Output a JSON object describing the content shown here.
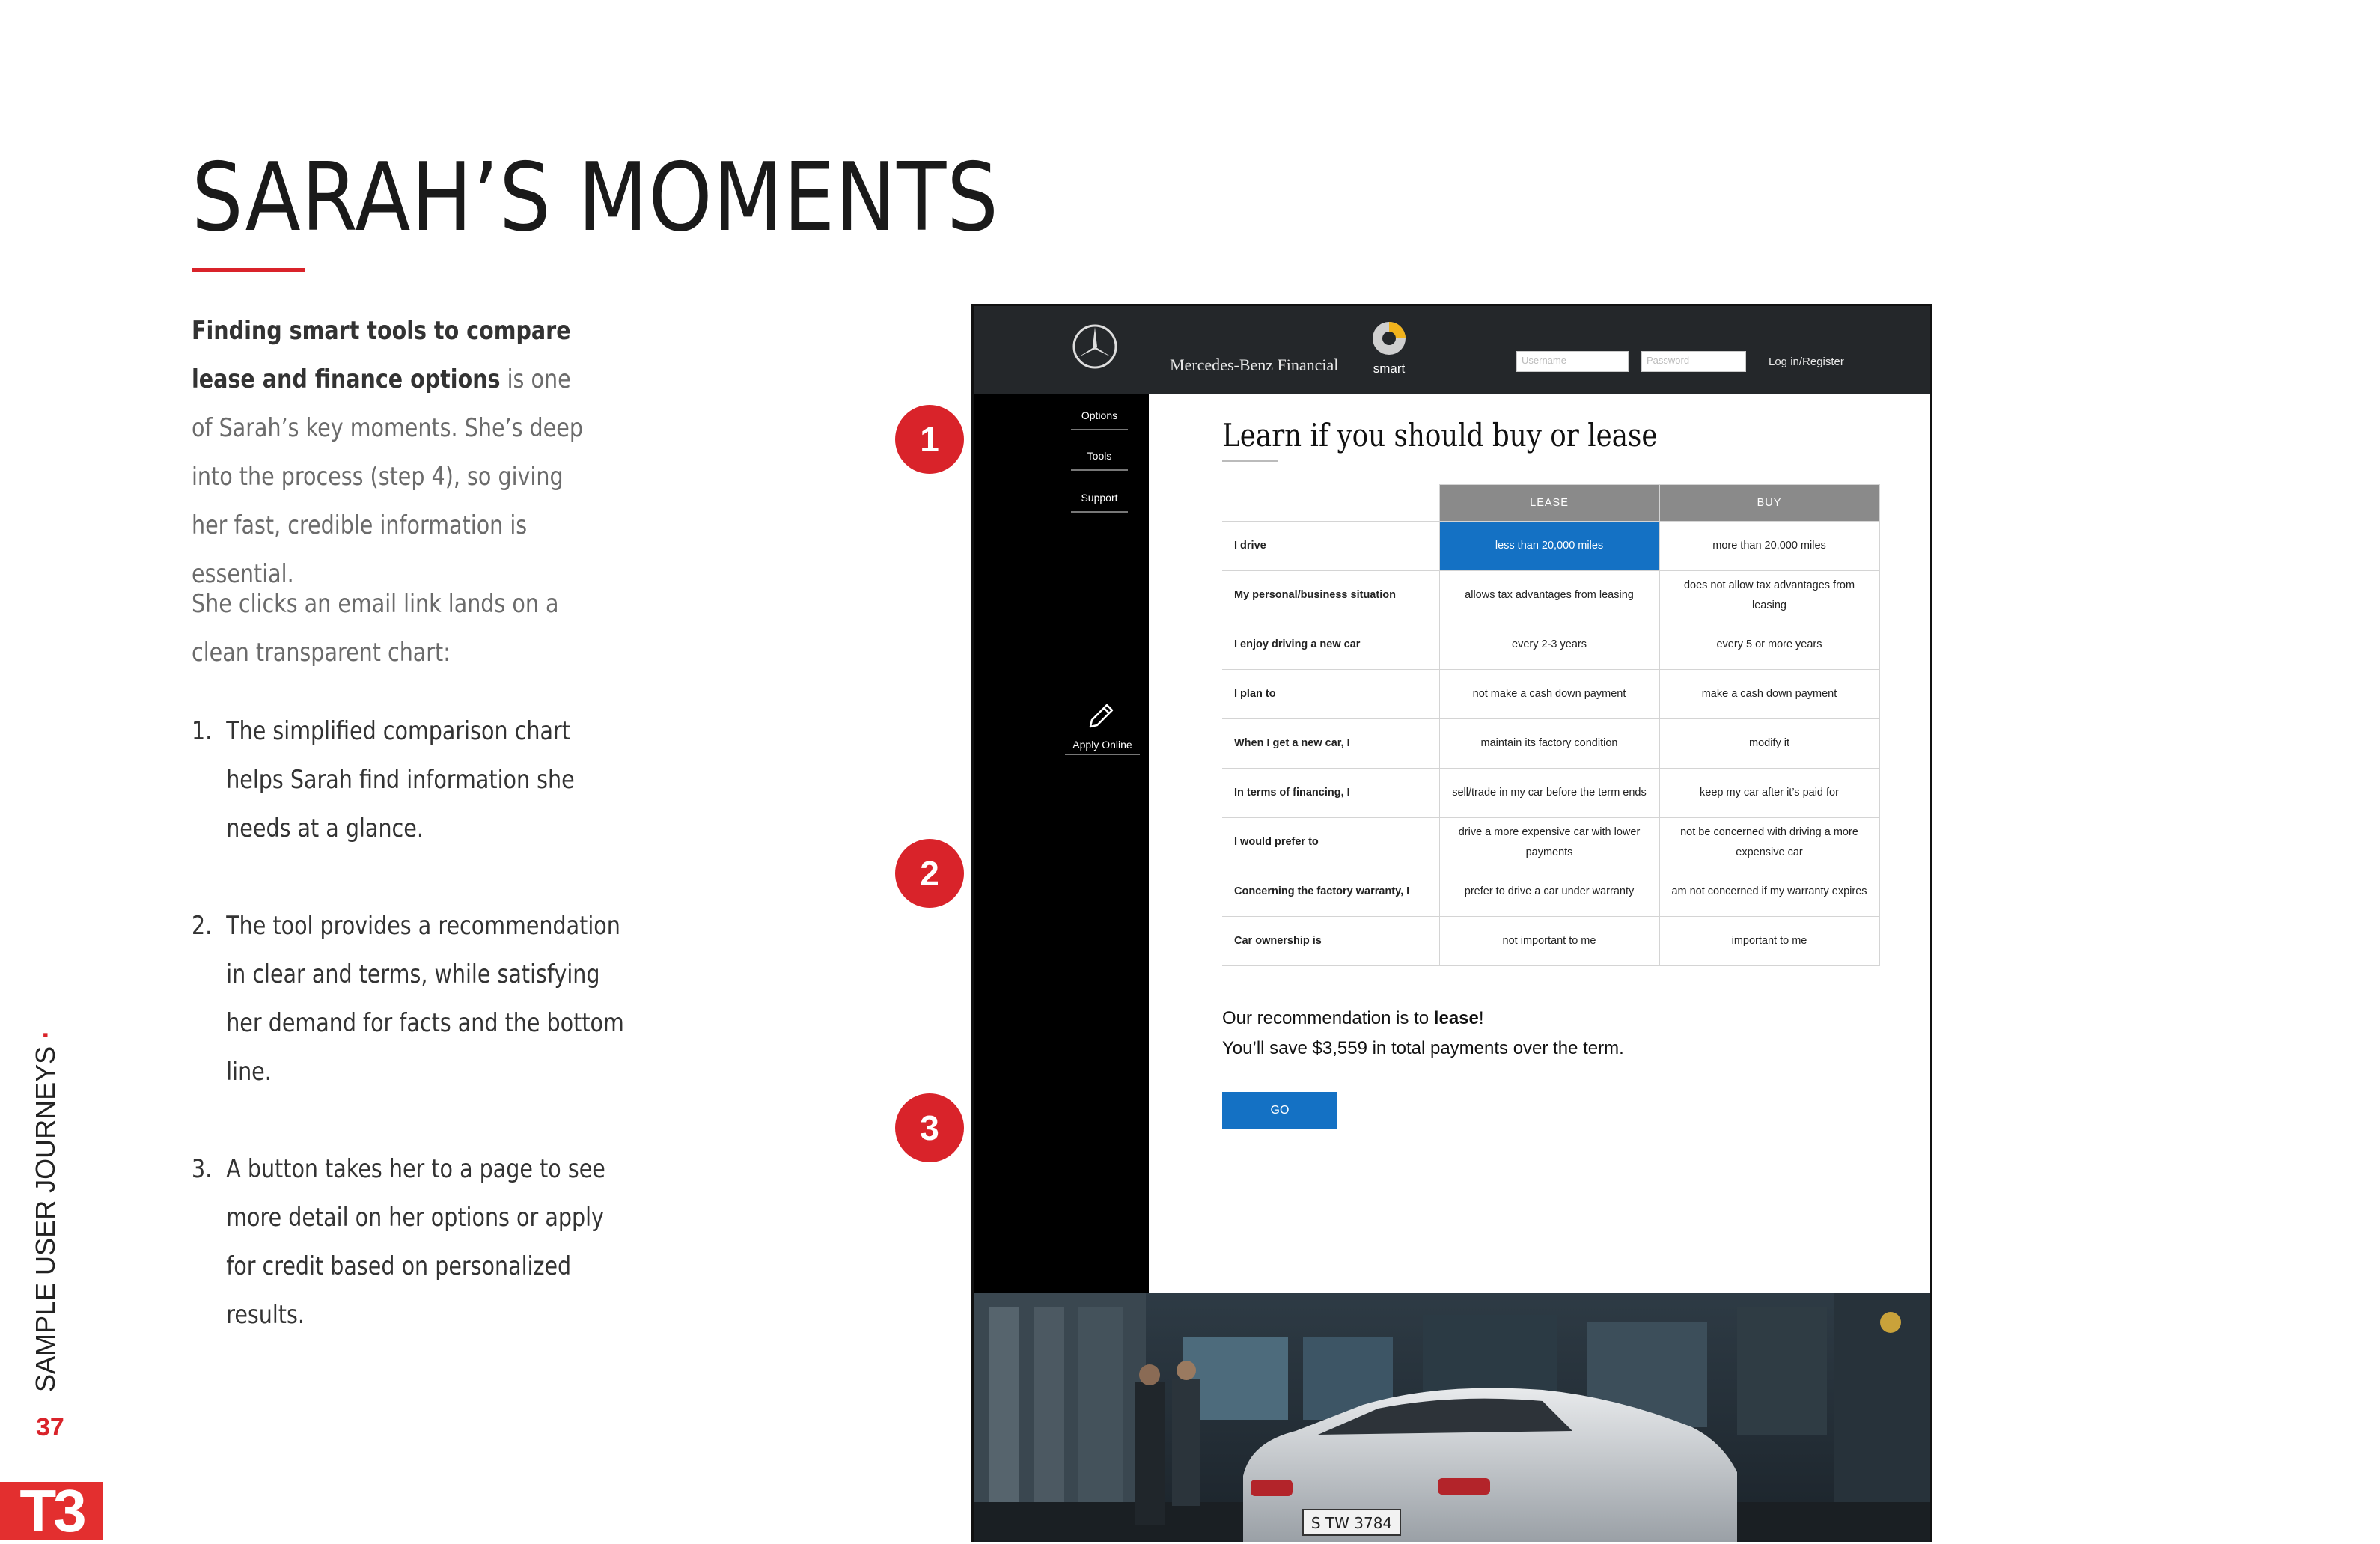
{
  "slide": {
    "title": "SARAH’S MOMENTS",
    "intro_bold": "Finding smart tools to compare lease and finance options",
    "intro_rest": " is one of Sarah’s key moments. She’s deep into the process (step 4), so giving her fast, credible information is essential.",
    "paragraph2": "She clicks an email link lands on a clean transparent chart:",
    "list": [
      {
        "num": "1.",
        "text": "The simplified comparison chart helps Sarah find information she needs at a glance."
      },
      {
        "num": "2.",
        "text": "The tool provides a recommendation in clear and terms, while satisfying her demand for facts and the bottom line."
      },
      {
        "num": "3.",
        "text": "A button takes her to a page to see more detail on her options or apply for credit based on personalized results."
      }
    ],
    "side_label": "SAMPLE USER JOURNEYS",
    "side_dot": "·",
    "page_number": "37",
    "logo": "T3",
    "accent_color": "#d9232a"
  },
  "badges": [
    "1",
    "2",
    "3"
  ],
  "mockup": {
    "header": {
      "brand": "Mercedes-Benz Financial",
      "smart": "smart",
      "username_placeholder": "Username",
      "password_placeholder": "Password",
      "login_link": "Log in/Register"
    },
    "sidebar": {
      "items": [
        "Options",
        "Tools",
        "Support"
      ],
      "apply": "Apply Online"
    },
    "heading": "Learn if you should buy or lease",
    "table": {
      "headers": [
        "LEASE",
        "BUY"
      ],
      "rows": [
        {
          "label": "I drive",
          "lease": "less than 20,000 miles",
          "buy": "more than 20,000 miles"
        },
        {
          "label": "My personal/business situation",
          "lease": "allows tax advantages from leasing",
          "buy": "does not allow tax advantages from leasing"
        },
        {
          "label": "I enjoy driving a new car",
          "lease": "every 2-3 years",
          "buy": "every 5 or more years"
        },
        {
          "label": "I plan to",
          "lease": "not make a cash down payment",
          "buy": "make a cash down payment"
        },
        {
          "label": "When I get a new car, I",
          "lease": "maintain its factory condition",
          "buy": "modify it"
        },
        {
          "label": "In terms of financing, I",
          "lease": "sell/trade in my car before the term ends",
          "buy": "keep my car after it’s paid for"
        },
        {
          "label": "I would prefer to",
          "lease": "drive a more expensive car with lower payments",
          "buy": "not be concerned with driving a more expensive car"
        },
        {
          "label": "Concerning the factory warranty, I",
          "lease": "prefer to drive a car under warranty",
          "buy": "am not concerned if my warranty expires"
        },
        {
          "label": "Car ownership is",
          "lease": "not important to me",
          "buy": "important to me"
        }
      ],
      "highlight_color": "#1471c4"
    },
    "recommendation": {
      "prefix": "Our recommendation is to ",
      "choice": "lease",
      "suffix": "!",
      "savings": "You’ll save $3,559 in total payments over the term."
    },
    "go_button": "GO",
    "photo_plate": "S TW 3784"
  }
}
